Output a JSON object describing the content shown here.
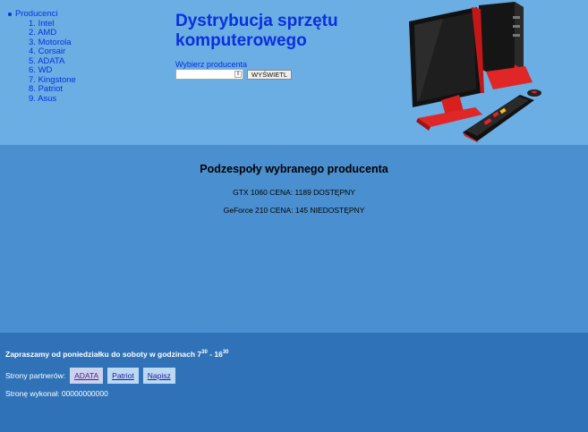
{
  "header": {
    "nav_parent": "Producenci",
    "manufacturers": [
      {
        "number": "1.",
        "name": "Intel"
      },
      {
        "number": "2.",
        "name": "AMD"
      },
      {
        "number": "3.",
        "name": "Motorola"
      },
      {
        "number": "4.",
        "name": "Corsair"
      },
      {
        "number": "5.",
        "name": "ADATA"
      },
      {
        "number": "6.",
        "name": "WD"
      },
      {
        "number": "7.",
        "name": "Kingstone"
      },
      {
        "number": "8.",
        "name": "Patriot"
      },
      {
        "number": "9.",
        "name": "Asus"
      }
    ],
    "title_line1": "Dystrybucja sprzętu",
    "title_line2": "komputerowego",
    "select_label": "Wybierz producenta",
    "select_value": "",
    "show_button": "WYŚWIETL"
  },
  "main": {
    "heading": "Podzespoły wybranego producenta",
    "products": [
      "GTX 1060 CENA: 1189 DOSTĘPNY",
      "GeForce 210 CENA: 145 NIEDOSTĘPNY"
    ]
  },
  "footer": {
    "hours_text": "Zapraszamy od poniedziałku do soboty w godzinach 7",
    "hours_start_sup": "30",
    "hours_sep": " - 16",
    "hours_end_sup": "30",
    "partners_label": "Strony partnerów:",
    "partners": [
      "ADATA",
      "Patriot",
      "Napisz"
    ],
    "author": "Stronę wykonał: 00000000000"
  },
  "colors": {
    "header_bg": "#6aaee4",
    "main_bg": "#4a90d0",
    "footer_bg": "#2f72b8",
    "link_blue": "#0b2fe0"
  },
  "icons": [
    "pc-computer-illustration"
  ]
}
